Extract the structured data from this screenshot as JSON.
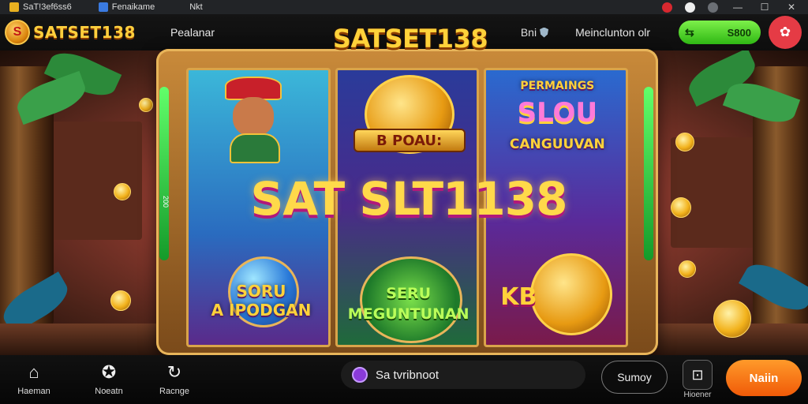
{
  "titlebar": {
    "tabs": [
      {
        "label": "SaT!3ef6ss6",
        "icon": "app-icon",
        "color": "#e8b020"
      },
      {
        "label": "Fenaikame",
        "icon": "window-icon",
        "color": "#3a7ae0"
      },
      {
        "label": "Nkt",
        "icon": "none",
        "color": ""
      }
    ],
    "controls": {
      "minimize": "—",
      "maximize": "☐",
      "close": "✕"
    }
  },
  "header": {
    "logo_text": "SATSET138",
    "logo_mark": "S",
    "nav_label": "Pealanar",
    "mid_label": "Bni",
    "link_label": "Meinclunton olr",
    "balance": "S800",
    "balance_icon": "swap-arrows-icon",
    "profile_icon": "gift-icon",
    "colors": {
      "balance": "#4cd624",
      "profile": "#e53b45",
      "logo": "#ffcf3d"
    }
  },
  "game": {
    "top_title": "SATSET138",
    "center_title": "SAT SLT1138",
    "side_number": "200",
    "reel_1": {
      "label": "SORU\nA IPODGAN"
    },
    "reel_2": {
      "plaque": "B POAU:",
      "label": "SERU\nMEGUNTUNAN"
    },
    "reel_3": {
      "top_small": "PERMAINGS",
      "top_big": "SLOU",
      "top_sub": "CANGUUVAN",
      "bottom_label": "KB"
    }
  },
  "bottom": {
    "nav": [
      {
        "label": "Haeman",
        "icon": "home-icon"
      },
      {
        "label": "Noeatn",
        "icon": "star-badge-icon"
      },
      {
        "label": "Racnge",
        "icon": "refresh-icon"
      }
    ],
    "promo_text": "Sa tvribnoot",
    "promo_icon": "chat-icon",
    "secondary_button": "Sumoy",
    "tile_label": "Hioener",
    "tile_icon": "bag-icon",
    "main_button": "Naiin",
    "colors": {
      "main_button": "#f57214"
    }
  }
}
